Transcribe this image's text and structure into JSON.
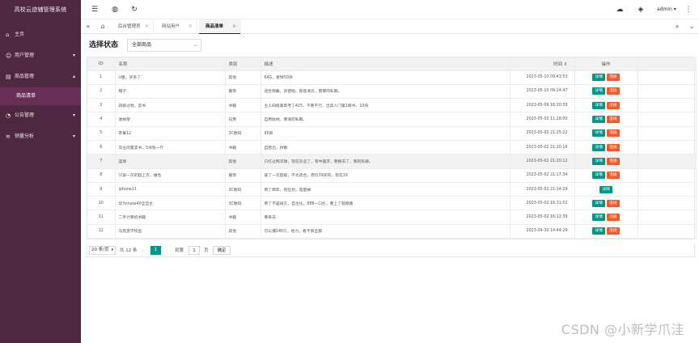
{
  "app": {
    "title": "高校云迹辅管理系统"
  },
  "sidebar": {
    "items": [
      {
        "label": "主页",
        "icon": "home-icon",
        "glyph": "⌂",
        "arrow": ""
      },
      {
        "label": "用户管理",
        "icon": "user-icon",
        "glyph": "☺",
        "arrow": "▾"
      },
      {
        "label": "商品管理",
        "icon": "goods-icon",
        "glyph": "▤",
        "arrow": "▴"
      },
      {
        "label": "公告管理",
        "icon": "notice-icon",
        "glyph": "◔",
        "arrow": "▾"
      },
      {
        "label": "销量分析",
        "icon": "chart-icon",
        "glyph": "≋",
        "arrow": "▾"
      }
    ],
    "submenu": {
      "label": "商品清单"
    }
  },
  "topbar": {
    "menu_glyph": "☰",
    "globe_glyph": "◍",
    "refresh_glyph": "↻",
    "theme_glyph": "☁",
    "tag_glyph": "◈",
    "user": "admin",
    "user_caret": "▾",
    "more_glyph": "⋮"
  },
  "tabs": {
    "prev_glyph": "«",
    "home_glyph": "⌂",
    "next_glyph": "»",
    "expand_glyph": "⌄",
    "items": [
      {
        "label": "后台管理员",
        "close": "×"
      },
      {
        "label": "网站用户",
        "close": "×"
      },
      {
        "label": "商品清单",
        "close": "×"
      }
    ]
  },
  "filter": {
    "label": "选择状态",
    "selected": "全部商品",
    "caret": "⌄"
  },
  "table": {
    "headers": {
      "id": "ID",
      "name": "名称",
      "category": "类别",
      "desc": "描述",
      "time": "时间 ⇕",
      "op": "操作"
    },
    "detail_label": "详情",
    "delete_label": "违规",
    "rows": [
      {
        "id": "1",
        "name": "U盘，买多了",
        "category": "其他",
        "desc": "64G，星球50块",
        "time": "2023-05-10 09:43:53",
        "delete": true
      },
      {
        "id": "2",
        "name": "帽子",
        "category": "服饰",
        "desc": "适合我戴，买错啦，帮帮清云，需要的私聊。",
        "time": "2023-05-10 09:24:47",
        "delete": true
      },
      {
        "id": "3",
        "name": "四级过啦，卖书",
        "category": "书籍",
        "desc": "主人四级第高考了425，不要不行，出卖入门第1版书，10块",
        "time": "2023-05-09 16:30:59",
        "delete": true
      },
      {
        "id": "4",
        "name": "收纳架",
        "category": "日用",
        "desc": "自用收纳，要清的私聊。",
        "time": "2023-05-03 11:28:00",
        "delete": true
      },
      {
        "id": "5",
        "name": "苹果12",
        "category": "3C数码",
        "desc": "95新",
        "time": "2023-05-02 21:25:22",
        "delete": true
      },
      {
        "id": "6",
        "name": "毕业闲置卖书，5块钱一斤",
        "category": "书籍",
        "desc": "自营出，拆散",
        "time": "2023-05-02 21:20:16",
        "delete": true
      },
      {
        "id": "7",
        "name": "篮球",
        "category": "其他",
        "desc": "只打过两次球，现在毕业了，有中国求，要换去了，要的私聊。",
        "time": "2023-05-02 21:20:12",
        "delete": true
      },
      {
        "id": "8",
        "name": "只穿一次的超上衣，裙色",
        "category": "服饰",
        "desc": "穿了一次超级，不太适合，原价39买的，现在19",
        "time": "2023-05-02 21:17:34",
        "delete": true
      },
      {
        "id": "9",
        "name": "iphone11",
        "category": "3C数码",
        "desc": "用了两年，有些划，电量掉",
        "time": "2023-05-02 21:14:29",
        "delete": false
      },
      {
        "id": "10",
        "name": "华为mate40全自主",
        "category": "3C数码",
        "desc": "用了不是很久，自主化，888一口价，要上了就跑路",
        "time": "2023-05-02 16:31:52",
        "delete": true
      },
      {
        "id": "11",
        "name": "二手计算机书籍",
        "category": "书籍",
        "desc": "要来去",
        "time": "2023-05-02 16:12:39",
        "delete": true
      },
      {
        "id": "12",
        "name": "马克思学校鱼",
        "category": "其他",
        "desc": "可以捕140只，给力，看不到全部",
        "time": "2023-04-30 14:44:29",
        "delete": true
      }
    ]
  },
  "pager": {
    "size": "20 条/页",
    "size_caret": "▾",
    "total": "共 12 条",
    "prev": "‹",
    "current": "1",
    "next": "›",
    "goto_label": "到第",
    "goto_value": "1",
    "page_unit": "页",
    "confirm": "确定"
  },
  "watermark": {
    "text": "CSDN @小新学爪洼"
  }
}
